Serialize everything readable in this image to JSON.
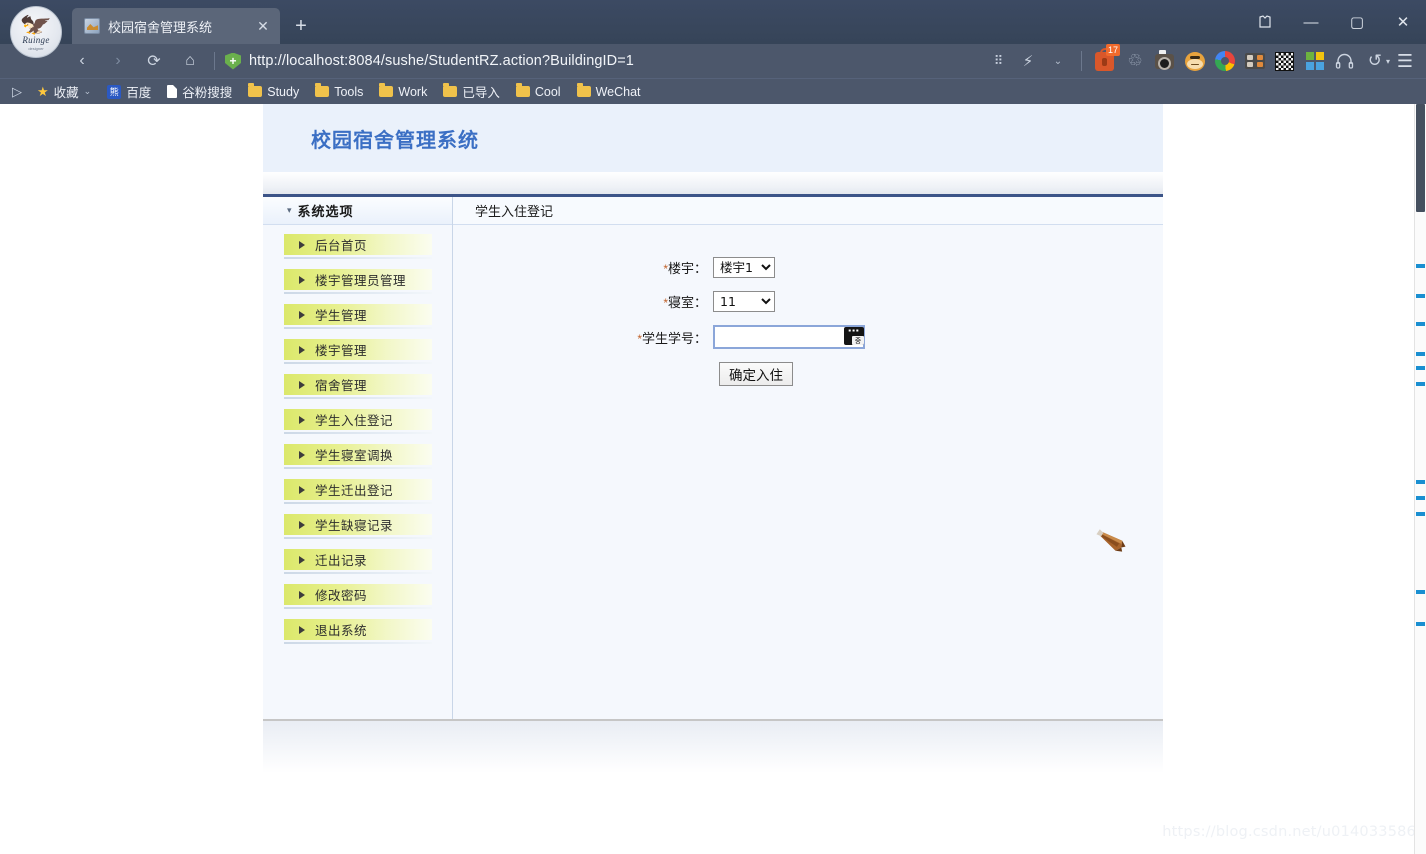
{
  "browser": {
    "logo": {
      "name": "ruinge-logo",
      "text": "Ruinge",
      "sub": "designer"
    },
    "tab": {
      "title": "校园宿舍管理系统",
      "close_label": "✕"
    },
    "newtab_label": "+",
    "window_controls": {
      "shirt": "shirt-icon",
      "minimize": "—",
      "maximize": "▢",
      "close": "✕"
    },
    "nav": {
      "back": "‹",
      "forward": "›",
      "reload": "⟳",
      "home": "⌂",
      "shield_label": "+",
      "url": "http://localhost:8084/sushe/StudentRZ.action?BuildingID=1"
    },
    "toolbar_icons": [
      {
        "name": "apps-grid-icon",
        "glyph": "⠿"
      },
      {
        "name": "lightning-icon",
        "glyph": "⚡"
      },
      {
        "name": "chevron-down-icon",
        "glyph": "⌄"
      },
      {
        "name": "security-lock-icon",
        "badge": "17"
      },
      {
        "name": "recycle-icon",
        "glyph": "♲"
      },
      {
        "name": "camera-icon"
      },
      {
        "name": "monkey-face-icon"
      },
      {
        "name": "chrome-icon"
      },
      {
        "name": "calculator-icon"
      },
      {
        "name": "qrcode-icon"
      },
      {
        "name": "microsoft-apps-icon"
      },
      {
        "name": "headphones-icon",
        "glyph": "⌒"
      },
      {
        "name": "undo-icon",
        "glyph": "↺"
      },
      {
        "name": "hamburger-menu-icon",
        "glyph": "☰"
      }
    ],
    "bookmarks": {
      "lead": "▷",
      "items": [
        {
          "label": "收藏",
          "icon": "star-icon",
          "chevron": "⌄"
        },
        {
          "label": "百度",
          "icon": "baidu-icon"
        },
        {
          "label": "谷粉搜搜",
          "icon": "document-icon"
        },
        {
          "label": "Study",
          "icon": "folder-icon"
        },
        {
          "label": "Tools",
          "icon": "folder-icon"
        },
        {
          "label": "Work",
          "icon": "folder-icon"
        },
        {
          "label": "已导入",
          "icon": "folder-icon"
        },
        {
          "label": "Cool",
          "icon": "folder-icon"
        },
        {
          "label": "WeChat",
          "icon": "folder-icon"
        }
      ]
    }
  },
  "site": {
    "title": "校园宿舍管理系统",
    "sidebar": {
      "header": "系统选项",
      "caret": "▾",
      "items": [
        {
          "label": "后台首页"
        },
        {
          "label": "楼宇管理员管理"
        },
        {
          "label": "学生管理"
        },
        {
          "label": "楼宇管理"
        },
        {
          "label": "宿舍管理"
        },
        {
          "label": "学生入住登记"
        },
        {
          "label": "学生寝室调换"
        },
        {
          "label": "学生迁出登记"
        },
        {
          "label": "学生缺寝记录"
        },
        {
          "label": "迁出记录"
        },
        {
          "label": "修改密码"
        },
        {
          "label": "退出系统"
        }
      ]
    },
    "content_tab": "学生入住登记",
    "form": {
      "building": {
        "required_mark": "*",
        "label": "楼宇：",
        "value": "楼宇1",
        "options": [
          "楼宇1"
        ]
      },
      "room": {
        "required_mark": "*",
        "label": "寝室：",
        "value": "11",
        "options": [
          "11"
        ]
      },
      "student_id": {
        "required_mark": "*",
        "label": "学生学号：",
        "value": "",
        "placeholder": ""
      },
      "submit_label": "确定入住",
      "ime_indicator": "ime-icon"
    }
  },
  "watermark": "https://blog.csdn.net/u014033586"
}
